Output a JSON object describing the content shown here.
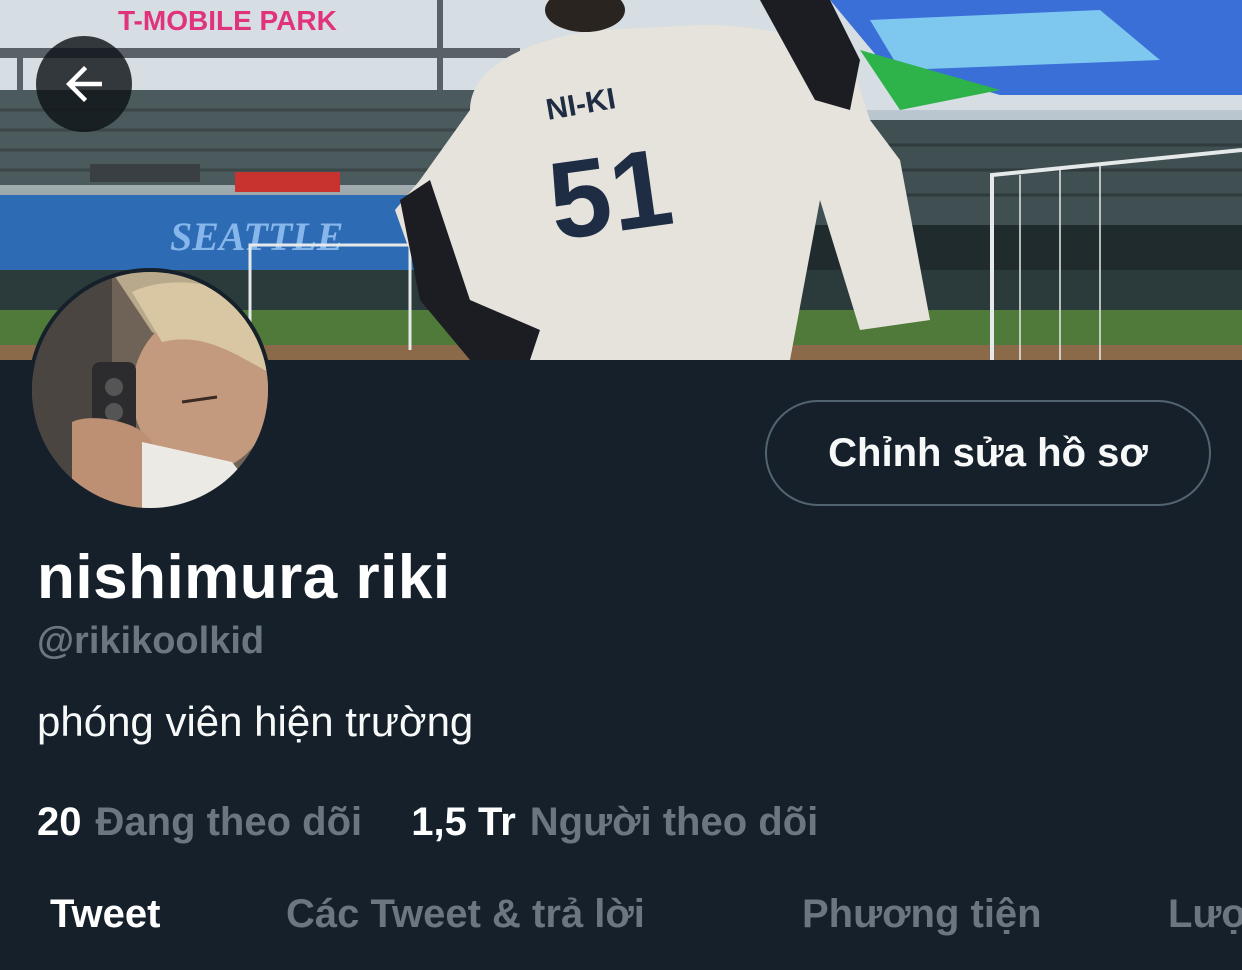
{
  "header": {
    "back_icon": "arrow-left-icon",
    "banner_texts": {
      "stadium_sign": "T-MOBILE PARK",
      "jersey_name": "NI-KI",
      "jersey_number": "51",
      "wall_sign": "SEATTLE"
    }
  },
  "profile": {
    "edit_label": "Chỉnh sửa hồ sơ",
    "name": "nishimura riki",
    "handle": "@rikikoolkid",
    "bio": "phóng viên hiện trường"
  },
  "stats": {
    "following_count": "20",
    "following_label": "Đang theo dõi",
    "followers_count": "1,5 Tr",
    "followers_label": "Người theo dõi"
  },
  "tabs": [
    {
      "label": "Tweet"
    },
    {
      "label": "Các Tweet & trả lời"
    },
    {
      "label": "Phương tiện"
    },
    {
      "label": "Lượt thích"
    }
  ],
  "colors": {
    "background": "#15202b",
    "text_primary": "#ffffff",
    "text_secondary": "#6b7680",
    "border": "#536471"
  }
}
